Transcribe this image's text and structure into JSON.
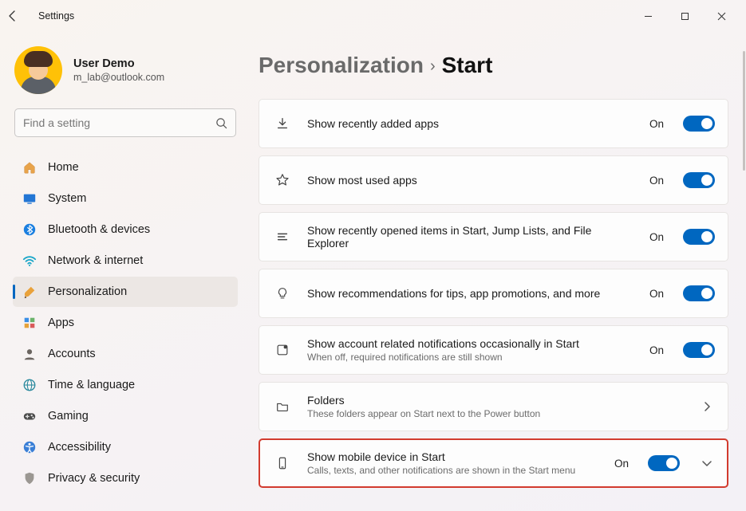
{
  "window": {
    "title": "Settings"
  },
  "user": {
    "name": "User Demo",
    "email": "m_lab@outlook.com"
  },
  "search": {
    "placeholder": "Find a setting"
  },
  "nav": {
    "items": [
      {
        "id": "home",
        "label": "Home",
        "icon": "home",
        "active": false
      },
      {
        "id": "system",
        "label": "System",
        "icon": "system",
        "active": false
      },
      {
        "id": "bluetooth",
        "label": "Bluetooth & devices",
        "icon": "bluetooth",
        "active": false
      },
      {
        "id": "network",
        "label": "Network & internet",
        "icon": "wifi",
        "active": false
      },
      {
        "id": "personalization",
        "label": "Personalization",
        "icon": "brush",
        "active": true
      },
      {
        "id": "apps",
        "label": "Apps",
        "icon": "apps",
        "active": false
      },
      {
        "id": "accounts",
        "label": "Accounts",
        "icon": "person",
        "active": false
      },
      {
        "id": "time",
        "label": "Time & language",
        "icon": "globe",
        "active": false
      },
      {
        "id": "gaming",
        "label": "Gaming",
        "icon": "gamepad",
        "active": false
      },
      {
        "id": "accessibility",
        "label": "Accessibility",
        "icon": "accessibility",
        "active": false
      },
      {
        "id": "privacy",
        "label": "Privacy & security",
        "icon": "shield",
        "active": false
      }
    ]
  },
  "breadcrumb": {
    "parent": "Personalization",
    "separator": "›",
    "current": "Start"
  },
  "settings": [
    {
      "id": "recently-added",
      "icon": "download",
      "title": "Show recently added apps",
      "subtitle": "",
      "state": "On",
      "toggle": true,
      "trailing": "",
      "highlight": false
    },
    {
      "id": "most-used",
      "icon": "star",
      "title": "Show most used apps",
      "subtitle": "",
      "state": "On",
      "toggle": true,
      "trailing": "",
      "highlight": false
    },
    {
      "id": "recent-items",
      "icon": "lines",
      "title": "Show recently opened items in Start, Jump Lists, and File Explorer",
      "subtitle": "",
      "state": "On",
      "toggle": true,
      "trailing": "",
      "highlight": false
    },
    {
      "id": "recommendations",
      "icon": "bulb",
      "title": "Show recommendations for tips, app promotions, and more",
      "subtitle": "",
      "state": "On",
      "toggle": true,
      "trailing": "",
      "highlight": false
    },
    {
      "id": "account-notifs",
      "icon": "badge",
      "title": "Show account related notifications occasionally in Start",
      "subtitle": "When off, required notifications are still shown",
      "state": "On",
      "toggle": true,
      "trailing": "",
      "highlight": false
    },
    {
      "id": "folders",
      "icon": "folder",
      "title": "Folders",
      "subtitle": "These folders appear on Start next to the Power button",
      "state": "",
      "toggle": false,
      "trailing": "chevron",
      "highlight": false
    },
    {
      "id": "mobile",
      "icon": "phone",
      "title": "Show mobile device in Start",
      "subtitle": "Calls, texts, and other notifications are shown in the Start menu",
      "state": "On",
      "toggle": true,
      "trailing": "expand",
      "highlight": true
    }
  ],
  "colors": {
    "accent": "#0067c0",
    "highlight_border": "#d23b2e"
  }
}
